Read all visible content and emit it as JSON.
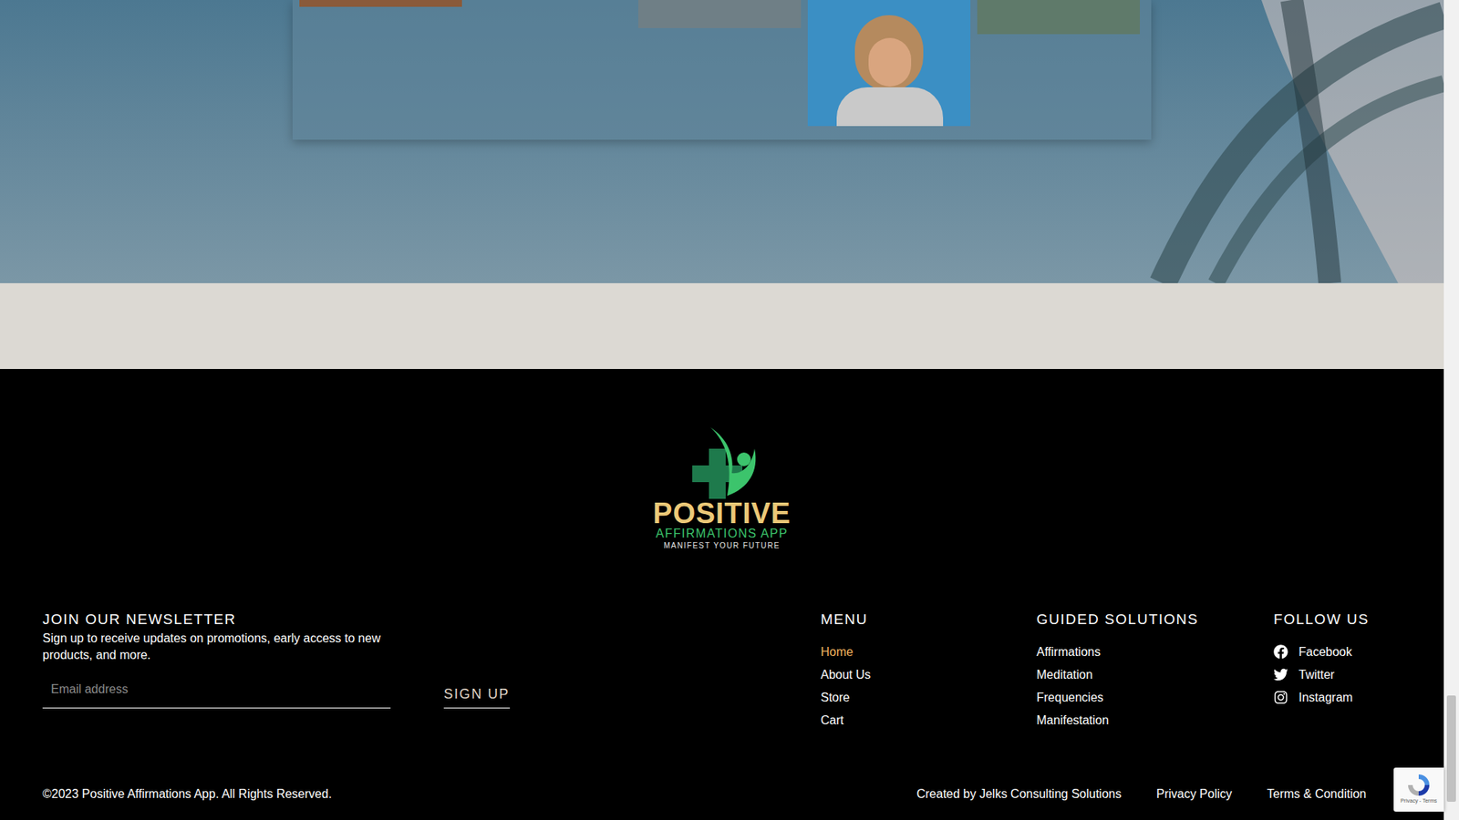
{
  "gallery": {
    "photos": [
      {
        "column": 0,
        "kind": "cut"
      },
      {
        "column": 2,
        "kind": "cut"
      },
      {
        "column": 3,
        "kind": "portrait"
      },
      {
        "column": 4,
        "kind": "cut"
      }
    ]
  },
  "logo": {
    "title": "POSITIVE",
    "subtitle": "AFFIRMATIONS APP",
    "tagline": "MANIFEST YOUR FUTURE"
  },
  "newsletter": {
    "heading": "JOIN OUR NEWSLETTER",
    "text": "Sign up to receive updates on promotions, early access to new products, and more.",
    "placeholder": "Email address",
    "button": "SIGN UP"
  },
  "menu": {
    "heading": "MENU",
    "items": [
      {
        "label": "Home",
        "selected": true
      },
      {
        "label": "About Us",
        "selected": false
      },
      {
        "label": "Store",
        "selected": false
      },
      {
        "label": "Cart",
        "selected": false
      }
    ]
  },
  "guided": {
    "heading": "GUIDED SOLUTIONS",
    "items": [
      "Affirmations",
      "Meditation",
      "Frequencies",
      "Manifestation"
    ]
  },
  "follow": {
    "heading": "FOLLOW US",
    "items": [
      {
        "label": "Facebook",
        "kind": "facebook"
      },
      {
        "label": "Twitter",
        "kind": "twitter"
      },
      {
        "label": "Instagram",
        "kind": "instagram"
      }
    ]
  },
  "bottom": {
    "copyright": "©2023 Positive Affirmations App. All Rights Reserved.",
    "links": [
      "Created by Jelks Consulting Solutions",
      "Privacy Policy",
      "Terms & Condition"
    ]
  },
  "recaptcha": {
    "text": "Privacy - Terms"
  },
  "scrollbar": {
    "level": 0.13
  }
}
